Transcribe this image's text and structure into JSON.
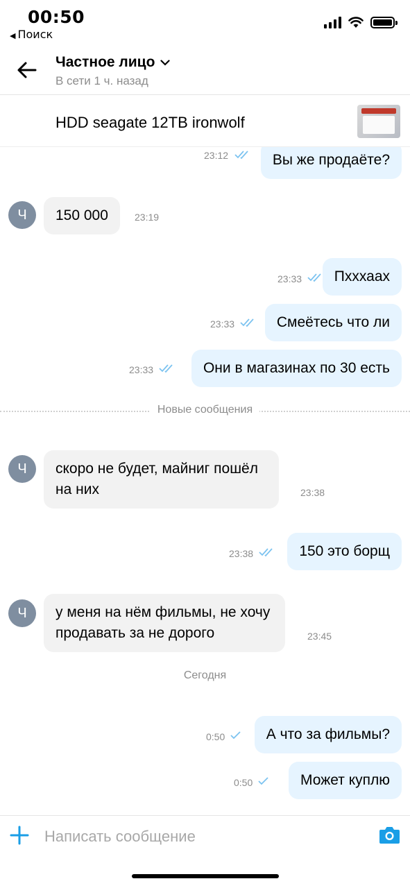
{
  "status_bar": {
    "time": "00:50",
    "back_label": "Поиск",
    "back_glyph": "◀"
  },
  "header": {
    "contact_name": "Частное лицо",
    "contact_status": "В сети 1 ч. назад"
  },
  "listing": {
    "title": "HDD seagate 12TB ironwolf"
  },
  "avatar_letter": "Ч",
  "messages": [
    {
      "dir": "out",
      "text": "Вы же продаёте?",
      "time": "23:12",
      "status": "read"
    },
    {
      "dir": "in",
      "text": "150 000",
      "time": "23:19"
    },
    {
      "dir": "out",
      "text": "Пхххаах",
      "time": "23:33",
      "status": "read"
    },
    {
      "dir": "out",
      "text": "Смеётесь что ли",
      "time": "23:33",
      "status": "read"
    },
    {
      "dir": "out",
      "text": "Они в магазинах по 30 есть",
      "time": "23:33",
      "status": "read"
    },
    {
      "dir": "in",
      "text_line1": "скоро не будет, майниг пошёл",
      "text_line2": "на них",
      "time": "23:38"
    },
    {
      "dir": "out",
      "text": "150 это борщ",
      "time": "23:38",
      "status": "read"
    },
    {
      "dir": "in",
      "text_line1": "у меня на нём фильмы, не хочу",
      "text_line2": "продавать за не дорого",
      "time": "23:45"
    },
    {
      "dir": "out",
      "text": "А что за фильмы?",
      "time": "0:50",
      "status": "sent"
    },
    {
      "dir": "out",
      "text": "Может куплю",
      "time": "0:50",
      "status": "sent"
    }
  ],
  "dividers": {
    "new_messages": "Новые сообщения",
    "today": "Сегодня"
  },
  "composer": {
    "placeholder": "Написать сообщение"
  },
  "colors": {
    "accent": "#1a9ee6",
    "outgoing_bubble": "#e6f4ff",
    "incoming_bubble": "#f2f2f2",
    "tick_read": "#7cc3f0",
    "avatar": "#7f8ea0"
  }
}
